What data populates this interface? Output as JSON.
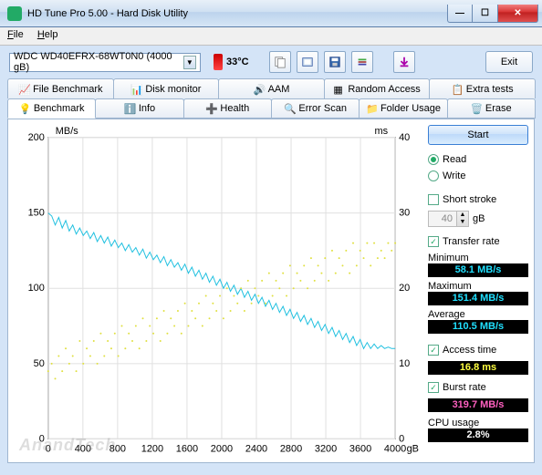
{
  "window": {
    "title": "HD Tune Pro 5.00 - Hard Disk Utility"
  },
  "menu": {
    "file": "File",
    "help": "Help"
  },
  "toolbar": {
    "drive": "WDC WD40EFRX-68WT0N0 (4000 gB)",
    "temperature": "33°C",
    "exit": "Exit"
  },
  "tabs_top": [
    {
      "label": "File Benchmark"
    },
    {
      "label": "Disk monitor"
    },
    {
      "label": "AAM"
    },
    {
      "label": "Random Access"
    },
    {
      "label": "Extra tests"
    }
  ],
  "tabs_bottom": [
    {
      "label": "Benchmark",
      "active": true
    },
    {
      "label": "Info"
    },
    {
      "label": "Health"
    },
    {
      "label": "Error Scan"
    },
    {
      "label": "Folder Usage"
    },
    {
      "label": "Erase"
    }
  ],
  "controls": {
    "start": "Start",
    "read": "Read",
    "write": "Write",
    "short_stroke": "Short stroke",
    "short_stroke_val": "40",
    "short_stroke_unit": "gB",
    "transfer_rate": "Transfer rate",
    "access_time": "Access time",
    "burst_rate": "Burst rate"
  },
  "stats": {
    "minimum_lbl": "Minimum",
    "minimum_val": "58.1 MB/s",
    "maximum_lbl": "Maximum",
    "maximum_val": "151.4 MB/s",
    "average_lbl": "Average",
    "average_val": "110.5 MB/s",
    "access_val": "16.8 ms",
    "burst_val": "319.7 MB/s",
    "cpu_lbl": "CPU usage",
    "cpu_val": "2.8%"
  },
  "chart_data": {
    "type": "line",
    "xlabel": "gB",
    "ylabel_left": "MB/s",
    "ylabel_right": "ms",
    "xlim": [
      0,
      4000
    ],
    "ylim_left": [
      0,
      200
    ],
    "ylim_right": [
      0,
      40
    ],
    "xticks": [
      0,
      400,
      800,
      1200,
      1600,
      2000,
      2400,
      2800,
      3200,
      3600,
      4000
    ],
    "yticks_left": [
      0,
      50,
      100,
      150,
      200
    ],
    "yticks_right": [
      0,
      10,
      20,
      30,
      40
    ],
    "series": [
      {
        "name": "Transfer rate (MB/s)",
        "axis": "left",
        "values": [
          150,
          148,
          142,
          147,
          140,
          145,
          138,
          142,
          136,
          140,
          135,
          138,
          133,
          137,
          131,
          135,
          130,
          134,
          128,
          132,
          127,
          130,
          125,
          129,
          124,
          127,
          122,
          126,
          120,
          124,
          119,
          122,
          117,
          121,
          115,
          119,
          114,
          117,
          112,
          116,
          110,
          114,
          108,
          112,
          106,
          110,
          104,
          108,
          102,
          106,
          100,
          104,
          98,
          102,
          96,
          100,
          94,
          98,
          92,
          96,
          90,
          94,
          88,
          92,
          86,
          90,
          84,
          88,
          82,
          86,
          80,
          84,
          78,
          82,
          76,
          80,
          74,
          78,
          72,
          76,
          70,
          74,
          68,
          72,
          66,
          70,
          64,
          68,
          62,
          66,
          60,
          64,
          60,
          63,
          60,
          62,
          60,
          61,
          60,
          60
        ]
      },
      {
        "name": "Access time (ms)",
        "axis": "right",
        "type": "scatter",
        "values": [
          9,
          10,
          8,
          11,
          9,
          12,
          10,
          11,
          9,
          13,
          10,
          12,
          11,
          13,
          10,
          14,
          11,
          13,
          12,
          14,
          11,
          15,
          12,
          14,
          13,
          15,
          12,
          16,
          13,
          15,
          14,
          16,
          13,
          17,
          14,
          16,
          15,
          17,
          14,
          18,
          15,
          17,
          16,
          18,
          15,
          19,
          16,
          18,
          17,
          19,
          16,
          20,
          17,
          19,
          18,
          20,
          17,
          21,
          18,
          20,
          19,
          21,
          18,
          22,
          19,
          21,
          20,
          22,
          19,
          23,
          20,
          22,
          21,
          23,
          20,
          24,
          21,
          23,
          22,
          24,
          21,
          25,
          22,
          24,
          23,
          25,
          22,
          26,
          23,
          25,
          24,
          26,
          23,
          26,
          24,
          25,
          24,
          26,
          25,
          26
        ]
      }
    ]
  },
  "watermark": "AnandTech"
}
